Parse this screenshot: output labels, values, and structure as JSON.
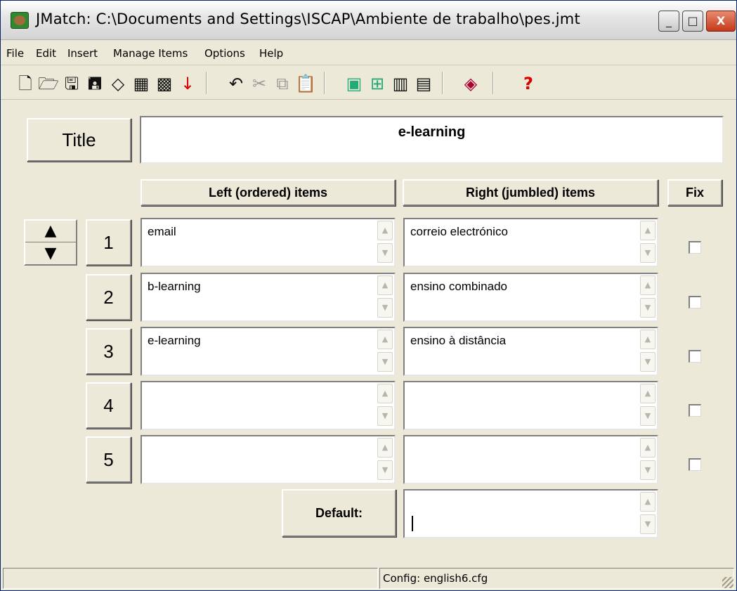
{
  "window": {
    "title": "JMatch: C:\\Documents and Settings\\ISCAP\\Ambiente de trabalho\\pes.jmt",
    "controls": {
      "minimize": "_",
      "maximize": "□",
      "close": "X"
    }
  },
  "menu": [
    "File",
    "Edit",
    "Insert",
    "Manage Items",
    "Options",
    "Help"
  ],
  "toolbar": {
    "icons": [
      "new-file-icon",
      "open-folder-icon",
      "save-icon",
      "save-as-icon",
      "export-icon",
      "web-page-icon",
      "web-page-alt-icon",
      "download-icon",
      "undo-icon",
      "cut-icon",
      "copy-icon",
      "paste-icon",
      "create-web-page-icon",
      "config-icon",
      "print-icon",
      "export-print-icon",
      "palette-icon",
      "help-icon"
    ]
  },
  "title_section": {
    "label": "Title",
    "value": "e-learning"
  },
  "headers": {
    "left": "Left (ordered) items",
    "right": "Right (jumbled) items",
    "fix": "Fix"
  },
  "rows": [
    {
      "num": "1",
      "left": "email",
      "right": "correio electrónico",
      "fix": false
    },
    {
      "num": "2",
      "left": "b-learning",
      "right": "ensino combinado",
      "fix": false
    },
    {
      "num": "3",
      "left": "e-learning",
      "right": "ensino à distância",
      "fix": false
    },
    {
      "num": "4",
      "left": "",
      "right": "",
      "fix": false
    },
    {
      "num": "5",
      "left": "",
      "right": "",
      "fix": false
    }
  ],
  "default": {
    "label": "Default:",
    "value": ""
  },
  "status": {
    "left": "",
    "right": "Config: english6.cfg"
  },
  "colors": {
    "window_bg": "#ece9d8",
    "field_bg": "#ffffff",
    "close_button": "#c4391a"
  }
}
